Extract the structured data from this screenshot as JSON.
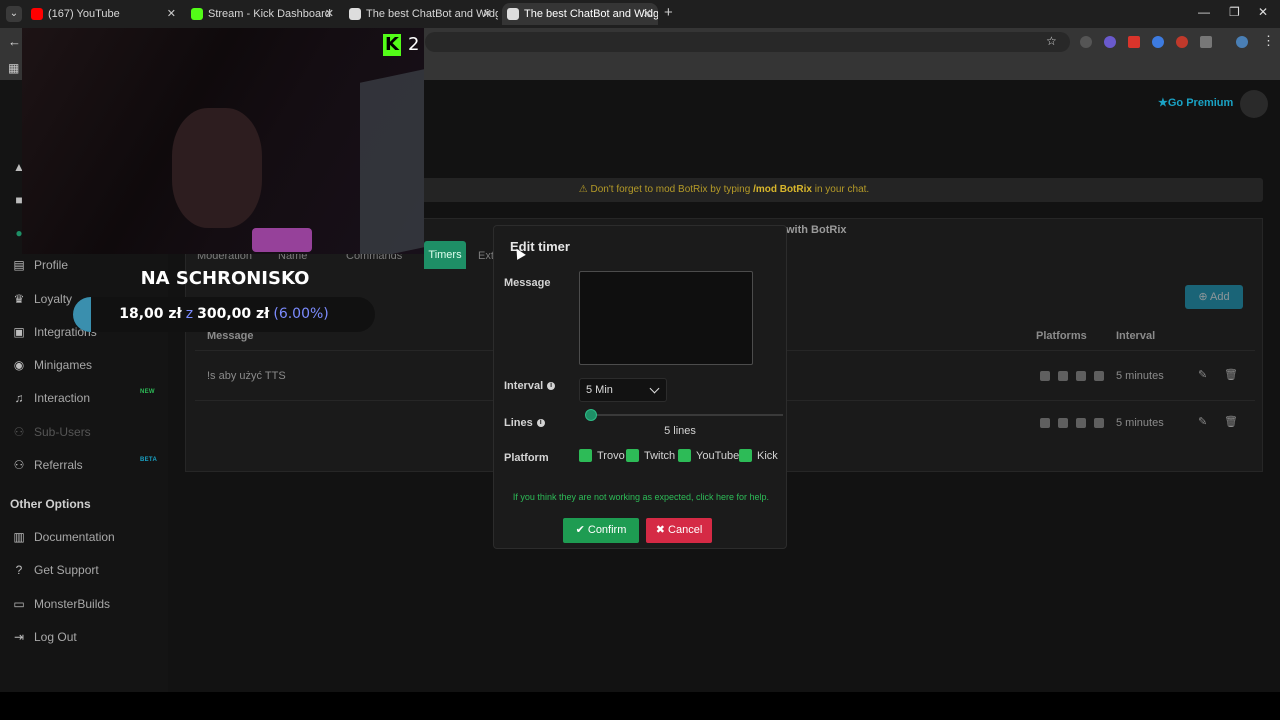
{
  "browser": {
    "tabs": [
      {
        "title": "(167) YouTube",
        "color": "#ff0000"
      },
      {
        "title": "Stream - Kick Dashboard",
        "color": "#53fc18"
      },
      {
        "title": "The best ChatBot and Widgets",
        "color": "#dddddd"
      },
      {
        "title": "The best ChatBot and Widgets",
        "color": "#dddddd"
      }
    ],
    "new_tab_icon": "+",
    "minimize_icon": "—",
    "restore_icon": "❐",
    "close_icon": "✕"
  },
  "header": {
    "premium_label": "Go Premium",
    "notice_prefix": "Don't forget to mod BotRix by typing ",
    "notice_command": "/mod BotRix",
    "notice_suffix": " in your chat."
  },
  "sidebar": {
    "items": [
      {
        "label": "Profile",
        "icon": "user-icon"
      },
      {
        "label": "Loyalty",
        "icon": "trophy-icon"
      },
      {
        "label": "Integrations",
        "icon": "puzzle-icon"
      },
      {
        "label": "Minigames",
        "icon": "gamepad-icon"
      },
      {
        "label": "Interaction",
        "icon": "music-icon",
        "badge": "NEW"
      },
      {
        "label": "Sub-Users",
        "icon": "users-icon"
      },
      {
        "label": "Referrals",
        "icon": "users-icon",
        "badge": "BETA"
      }
    ],
    "other_header": "Other Options",
    "other_items": [
      {
        "label": "Documentation",
        "icon": "book-icon"
      },
      {
        "label": "Get Support",
        "icon": "help-icon"
      },
      {
        "label": "MonsterBuilds",
        "icon": "laptop-icon"
      },
      {
        "label": "Log Out",
        "icon": "logout-icon"
      }
    ]
  },
  "panel": {
    "botrix_text": "with BotRix",
    "tabs": [
      "Moderation",
      "Name",
      "Commands",
      "Timers",
      "Ext"
    ],
    "add_label": "Add",
    "columns": {
      "message": "Message",
      "platforms": "Platforms",
      "interval": "Interval"
    },
    "rows": [
      {
        "message": "!s aby użyć TTS",
        "interval": "5 minutes"
      },
      {
        "message": "",
        "interval": "5 minutes"
      }
    ]
  },
  "overlay": {
    "kick_logo": "K",
    "viewer_count": "2",
    "goal_title": "NA SCHRONISKO",
    "goal_current": "18,00 zł",
    "goal_separator": "z",
    "goal_target": "300,00 zł",
    "goal_percent": "(6.00%)",
    "goal_progress": 0.06
  },
  "modal": {
    "title": "Edit timer",
    "message_label": "Message",
    "message_value": "",
    "interval_label": "Interval",
    "interval_value": "5 Min",
    "lines_label": "Lines",
    "lines_value": "5 lines",
    "platform_label": "Platform",
    "platforms": [
      "Trovo",
      "Twitch",
      "YouTube",
      "Kick"
    ],
    "help_text": "If you think they are not working as expected, click here for help.",
    "confirm_label": "Confirm",
    "cancel_label": "Cancel"
  }
}
